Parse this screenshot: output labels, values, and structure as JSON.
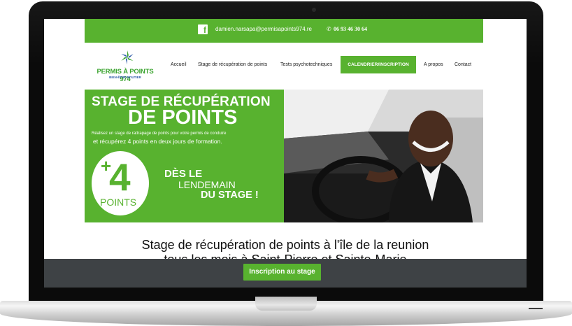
{
  "topbar": {
    "facebook_icon": "facebook-icon",
    "email": "damien.narsapa@permisapoints974.re",
    "phone_icon": "phone-icon",
    "phone": "06 93 46 30 64"
  },
  "logo": {
    "title": "PERMIS À POINTS 974",
    "subtitle": "BIEN-ÊTRE ROUTIER"
  },
  "nav": {
    "items": [
      "Accueil",
      "Stage de récupération de points",
      "Tests psychotechniques"
    ],
    "cta": "CALENDRIER/INSCRIPTION",
    "items_after": [
      "A propos",
      "Contact"
    ]
  },
  "hero": {
    "title_line1": "STAGE DE RÉCUPÉRATION",
    "title_line2": "DE POINTS",
    "text_line1": "Réalisez un stage de rattrapage de points pour votre permis de conduire",
    "text_line2": "et récupérez 4 points en deux jours de formation.",
    "badge_plus": "+",
    "badge_number": "4",
    "badge_label": "POINTS",
    "des_line1": "DÈS LE",
    "des_line2": "LENDEMAIN",
    "des_line3": "DU STAGE !"
  },
  "content": {
    "headline_line1": "Stage de récupération de points à l'île de la reunion",
    "headline_line2": "tous les mois à Saint-Pierre et Sainte-Marie"
  },
  "footer": {
    "button": "Inscription au stage"
  },
  "colors": {
    "brand_green": "#58b22f",
    "footer_dark": "#3e4245"
  }
}
